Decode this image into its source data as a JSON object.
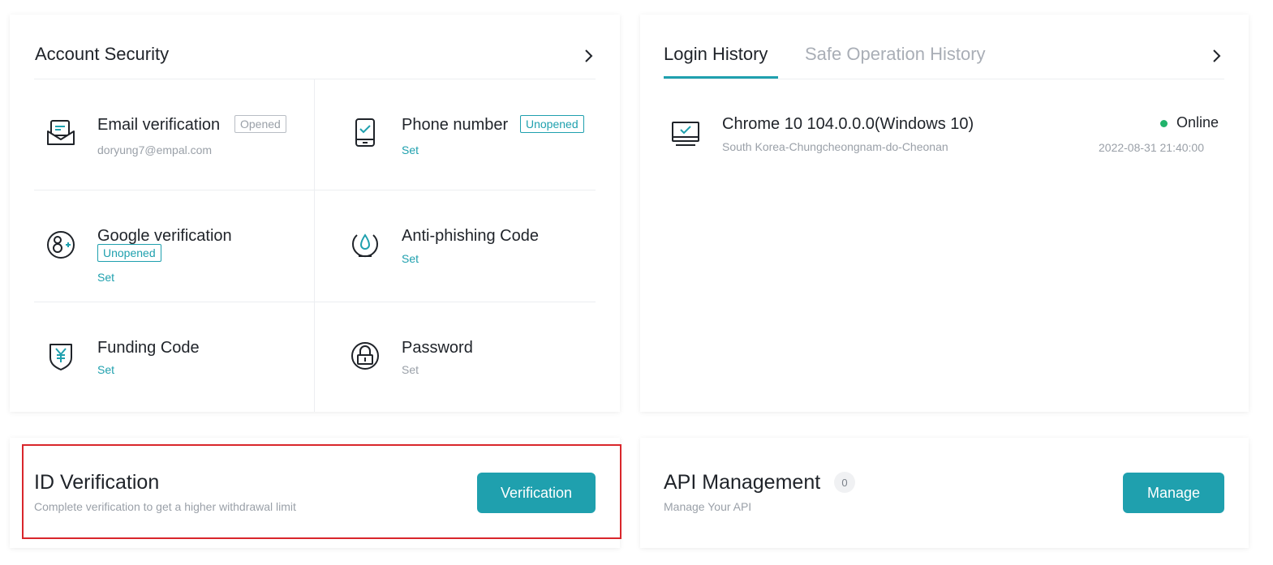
{
  "account_security": {
    "title": "Account Security",
    "items": [
      {
        "name": "Email verification",
        "badge": "Opened",
        "sub": "doryung7@empal.com",
        "icon": "email-icon"
      },
      {
        "name": "Phone number",
        "badge": "Unopened",
        "sub": "Set",
        "icon": "phone-icon"
      },
      {
        "name": "Google verification",
        "badge": "Unopened",
        "sub": "Set",
        "icon": "google-icon"
      },
      {
        "name": "Anti-phishing Code",
        "sub": "Set",
        "icon": "anti-phishing-icon"
      },
      {
        "name": "Funding Code",
        "sub": "Set",
        "icon": "funding-shield-icon"
      },
      {
        "name": "Password",
        "sub": "Set",
        "icon": "lock-icon"
      }
    ]
  },
  "history": {
    "tabs": [
      "Login History",
      "Safe Operation History"
    ],
    "entries": [
      {
        "device": "Chrome 10 104.0.0.0(Windows 10)",
        "location": "South Korea-Chungcheongnam-do-Cheonan",
        "status": "Online",
        "time": "2022-08-31 21:40:00"
      }
    ]
  },
  "id_verification": {
    "title": "ID Verification",
    "subtitle": "Complete verification to get a higher withdrawal limit",
    "button": "Verification"
  },
  "api_management": {
    "title": "API Management",
    "count": "0",
    "subtitle": "Manage Your API",
    "button": "Manage"
  },
  "colors": {
    "accent": "#1fa0ae",
    "online": "#21b36b",
    "highlight": "#d9262b"
  }
}
